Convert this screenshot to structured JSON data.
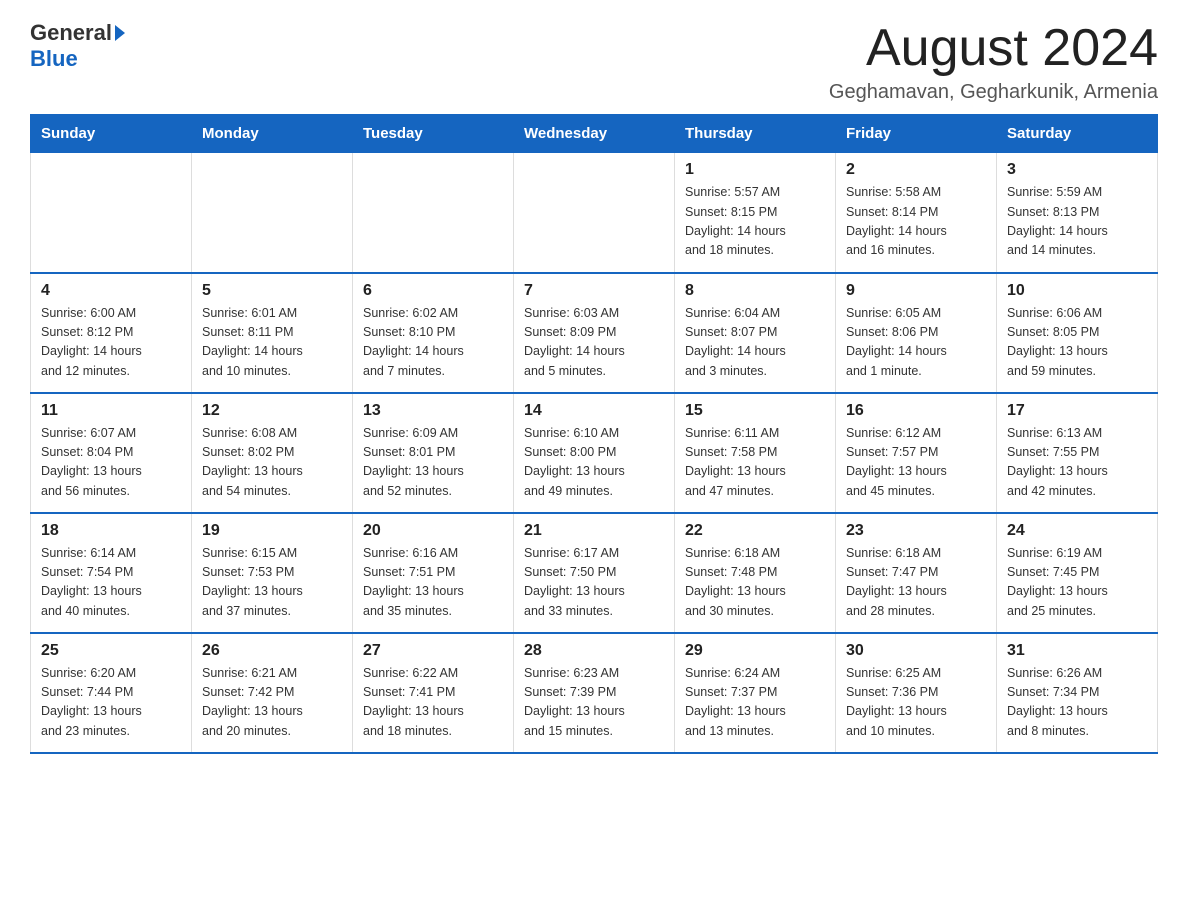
{
  "logo": {
    "general": "General",
    "blue": "Blue"
  },
  "title": "August 2024",
  "location": "Geghamavan, Gegharkunik, Armenia",
  "days_of_week": [
    "Sunday",
    "Monday",
    "Tuesday",
    "Wednesday",
    "Thursday",
    "Friday",
    "Saturday"
  ],
  "weeks": [
    [
      {
        "day": "",
        "info": ""
      },
      {
        "day": "",
        "info": ""
      },
      {
        "day": "",
        "info": ""
      },
      {
        "day": "",
        "info": ""
      },
      {
        "day": "1",
        "info": "Sunrise: 5:57 AM\nSunset: 8:15 PM\nDaylight: 14 hours\nand 18 minutes."
      },
      {
        "day": "2",
        "info": "Sunrise: 5:58 AM\nSunset: 8:14 PM\nDaylight: 14 hours\nand 16 minutes."
      },
      {
        "day": "3",
        "info": "Sunrise: 5:59 AM\nSunset: 8:13 PM\nDaylight: 14 hours\nand 14 minutes."
      }
    ],
    [
      {
        "day": "4",
        "info": "Sunrise: 6:00 AM\nSunset: 8:12 PM\nDaylight: 14 hours\nand 12 minutes."
      },
      {
        "day": "5",
        "info": "Sunrise: 6:01 AM\nSunset: 8:11 PM\nDaylight: 14 hours\nand 10 minutes."
      },
      {
        "day": "6",
        "info": "Sunrise: 6:02 AM\nSunset: 8:10 PM\nDaylight: 14 hours\nand 7 minutes."
      },
      {
        "day": "7",
        "info": "Sunrise: 6:03 AM\nSunset: 8:09 PM\nDaylight: 14 hours\nand 5 minutes."
      },
      {
        "day": "8",
        "info": "Sunrise: 6:04 AM\nSunset: 8:07 PM\nDaylight: 14 hours\nand 3 minutes."
      },
      {
        "day": "9",
        "info": "Sunrise: 6:05 AM\nSunset: 8:06 PM\nDaylight: 14 hours\nand 1 minute."
      },
      {
        "day": "10",
        "info": "Sunrise: 6:06 AM\nSunset: 8:05 PM\nDaylight: 13 hours\nand 59 minutes."
      }
    ],
    [
      {
        "day": "11",
        "info": "Sunrise: 6:07 AM\nSunset: 8:04 PM\nDaylight: 13 hours\nand 56 minutes."
      },
      {
        "day": "12",
        "info": "Sunrise: 6:08 AM\nSunset: 8:02 PM\nDaylight: 13 hours\nand 54 minutes."
      },
      {
        "day": "13",
        "info": "Sunrise: 6:09 AM\nSunset: 8:01 PM\nDaylight: 13 hours\nand 52 minutes."
      },
      {
        "day": "14",
        "info": "Sunrise: 6:10 AM\nSunset: 8:00 PM\nDaylight: 13 hours\nand 49 minutes."
      },
      {
        "day": "15",
        "info": "Sunrise: 6:11 AM\nSunset: 7:58 PM\nDaylight: 13 hours\nand 47 minutes."
      },
      {
        "day": "16",
        "info": "Sunrise: 6:12 AM\nSunset: 7:57 PM\nDaylight: 13 hours\nand 45 minutes."
      },
      {
        "day": "17",
        "info": "Sunrise: 6:13 AM\nSunset: 7:55 PM\nDaylight: 13 hours\nand 42 minutes."
      }
    ],
    [
      {
        "day": "18",
        "info": "Sunrise: 6:14 AM\nSunset: 7:54 PM\nDaylight: 13 hours\nand 40 minutes."
      },
      {
        "day": "19",
        "info": "Sunrise: 6:15 AM\nSunset: 7:53 PM\nDaylight: 13 hours\nand 37 minutes."
      },
      {
        "day": "20",
        "info": "Sunrise: 6:16 AM\nSunset: 7:51 PM\nDaylight: 13 hours\nand 35 minutes."
      },
      {
        "day": "21",
        "info": "Sunrise: 6:17 AM\nSunset: 7:50 PM\nDaylight: 13 hours\nand 33 minutes."
      },
      {
        "day": "22",
        "info": "Sunrise: 6:18 AM\nSunset: 7:48 PM\nDaylight: 13 hours\nand 30 minutes."
      },
      {
        "day": "23",
        "info": "Sunrise: 6:18 AM\nSunset: 7:47 PM\nDaylight: 13 hours\nand 28 minutes."
      },
      {
        "day": "24",
        "info": "Sunrise: 6:19 AM\nSunset: 7:45 PM\nDaylight: 13 hours\nand 25 minutes."
      }
    ],
    [
      {
        "day": "25",
        "info": "Sunrise: 6:20 AM\nSunset: 7:44 PM\nDaylight: 13 hours\nand 23 minutes."
      },
      {
        "day": "26",
        "info": "Sunrise: 6:21 AM\nSunset: 7:42 PM\nDaylight: 13 hours\nand 20 minutes."
      },
      {
        "day": "27",
        "info": "Sunrise: 6:22 AM\nSunset: 7:41 PM\nDaylight: 13 hours\nand 18 minutes."
      },
      {
        "day": "28",
        "info": "Sunrise: 6:23 AM\nSunset: 7:39 PM\nDaylight: 13 hours\nand 15 minutes."
      },
      {
        "day": "29",
        "info": "Sunrise: 6:24 AM\nSunset: 7:37 PM\nDaylight: 13 hours\nand 13 minutes."
      },
      {
        "day": "30",
        "info": "Sunrise: 6:25 AM\nSunset: 7:36 PM\nDaylight: 13 hours\nand 10 minutes."
      },
      {
        "day": "31",
        "info": "Sunrise: 6:26 AM\nSunset: 7:34 PM\nDaylight: 13 hours\nand 8 minutes."
      }
    ]
  ]
}
